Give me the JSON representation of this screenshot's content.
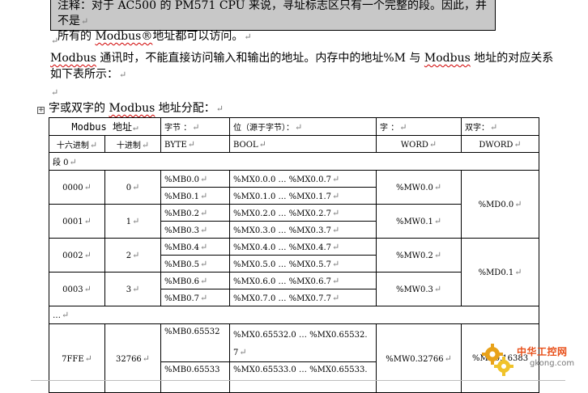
{
  "note": {
    "line1": "注释：对于 AC500 的 PM571 CPU 来说，寻址标志区只有一个完整的段。因此，并不是",
    "line2_pre": "所有的 ",
    "line2_word": "Modbus®",
    "line2_post": "地址都可以访问。"
  },
  "paragraph": {
    "text1_pre": "Modbus",
    "text1_post": " 通讯时，不能直接访问输入和输出的地址。内存中的地址%M 与 ",
    "text1_word": "Modbus",
    "text1_end": " 地址的对应关系",
    "text2": "如下表所示："
  },
  "caption": {
    "pre": "字或双字的 ",
    "word": "Modbus",
    "post": " 地址分配："
  },
  "para_mark": "↵",
  "table": {
    "header1": {
      "modbus": "Modbus 地址",
      "byte": "字节 ：",
      "bool": "位（源于字节）：",
      "word": "字 ：",
      "dword": "双字："
    },
    "header2": {
      "hex": "十六进制",
      "dec": "十进制",
      "byte": "BYTE",
      "bool": "BOOL",
      "word": "WORD",
      "dword": "DWORD"
    },
    "segment": "段 0",
    "ellipsis": "…",
    "rows": [
      {
        "hex": "0000",
        "dec": "0",
        "bytes": [
          "%MB0.0",
          "%MB0.1"
        ],
        "bools": [
          "%MX0.0.0 … %MX0.0.7",
          "%MX0.1.0 … %MX0.1.7"
        ],
        "word": "%MW0.0"
      },
      {
        "hex": "0001",
        "dec": "1",
        "bytes": [
          "%MB0.2",
          "%MB0.3"
        ],
        "bools": [
          "%MX0.2.0 … %MX0.2.7",
          "%MX0.3.0 … %MX0.3.7"
        ],
        "word": "%MW0.1"
      },
      {
        "hex": "0002",
        "dec": "2",
        "bytes": [
          "%MB0.4",
          "%MB0.5"
        ],
        "bools": [
          "%MX0.4.0 … %MX0.4.7",
          "%MX0.5.0 … %MX0.5.7"
        ],
        "word": "%MW0.2"
      },
      {
        "hex": "0003",
        "dec": "3",
        "bytes": [
          "%MB0.6",
          "%MB0.7"
        ],
        "bools": [
          "%MX0.6.0 … %MX0.6.7",
          "%MX0.7.0 … %MX0.7.7"
        ],
        "word": "%MW0.3"
      }
    ],
    "dwords": [
      "%MD0.0",
      "%MD0.1"
    ],
    "last": {
      "hex": "7FFE",
      "dec": "32766",
      "byte1": "%MB0.65532",
      "byte2": "%MB0.65533",
      "bool1a": "%MX0.65532.0 … %MX0.65532.",
      "bool1b": "7",
      "bool2": "%MX0.65533.0 … %MX0.65533.",
      "word": "%MW0.32766",
      "dword": "%MD0.16383"
    }
  },
  "watermark": {
    "name": "中华工控网",
    "url": "gkong.com"
  }
}
